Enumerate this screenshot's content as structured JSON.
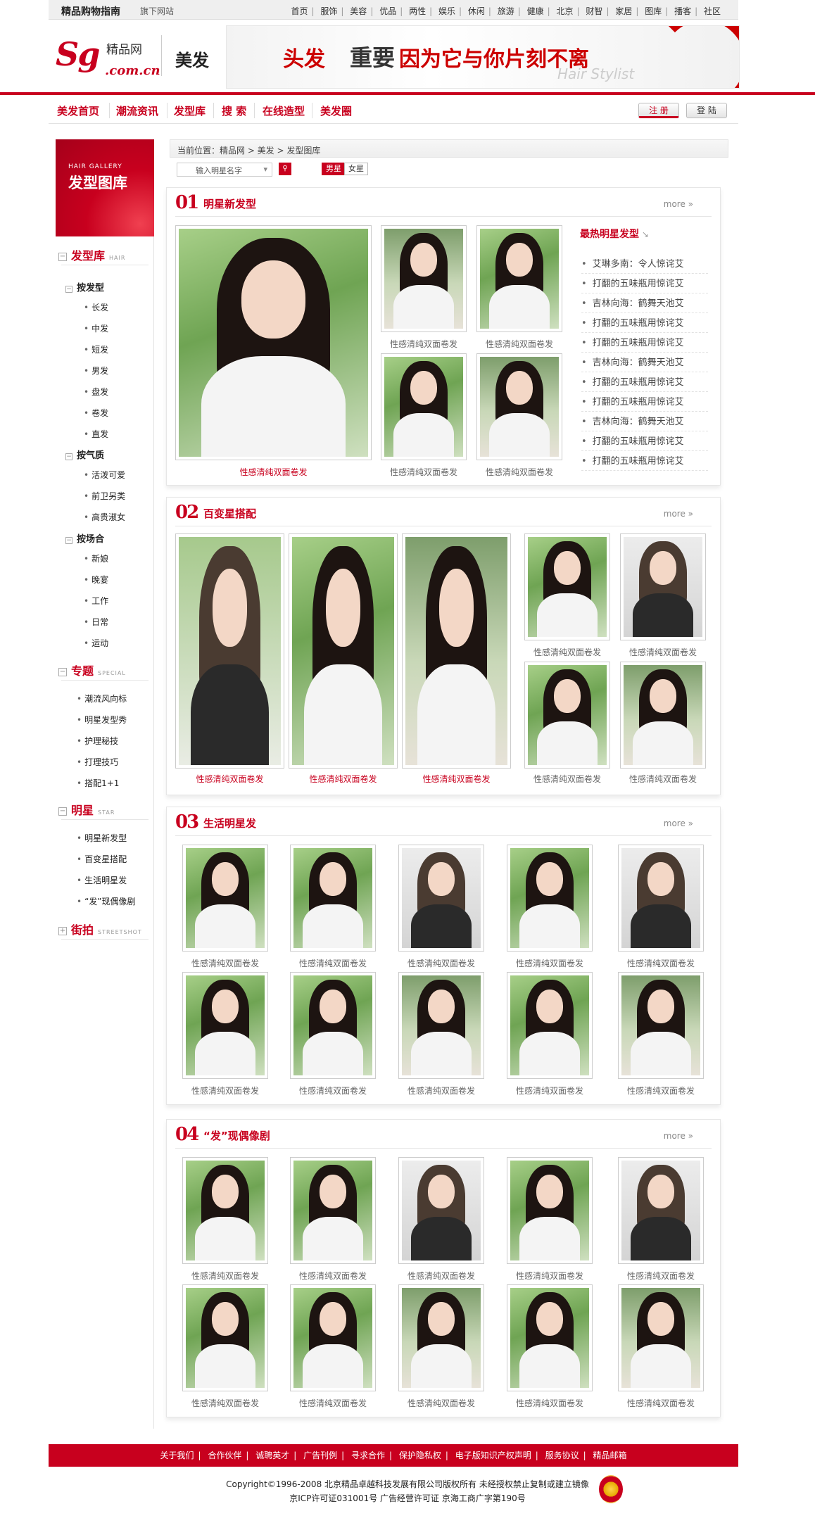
{
  "topbar": {
    "logo": "精品购物指南",
    "sub": "旗下网站",
    "nav": [
      "首页",
      "服饰",
      "美容",
      "优品",
      "两性",
      "娱乐",
      "休闲",
      "旅游",
      "健康",
      "北京",
      "财智",
      "家居",
      "图库",
      "播客",
      "社区"
    ]
  },
  "header": {
    "logo_main": "Sg",
    "logo_sub": ".com.cn",
    "logo_cn": "精品网",
    "section": "美发",
    "banner": {
      "t1": "头发",
      "t2": "重要",
      "t3": "因为它与你片刻不离",
      "t4": "Hair Stylist"
    }
  },
  "mainnav": {
    "items": [
      "美发首页",
      "潮流资讯",
      "发型库",
      "搜 索",
      "在线造型",
      "美发圈"
    ],
    "register": "注 册",
    "login": "登 陆"
  },
  "sidebar": {
    "gallery_en": "HAIR GALLERY",
    "gallery_cn": "发型图库",
    "sec1": {
      "title": "发型库",
      "en": "HAIR"
    },
    "by_length": {
      "title": "按发型",
      "items": [
        "长发",
        "中发",
        "短发",
        "男发",
        "盘发",
        "卷发",
        "直发"
      ]
    },
    "by_temper": {
      "title": "按气质",
      "items": [
        "活泼可爱",
        "前卫另类",
        "高贵淑女"
      ]
    },
    "by_occasion": {
      "title": "按场合",
      "items": [
        "新娘",
        "晚宴",
        "工作",
        "日常",
        "运动"
      ]
    },
    "sec2": {
      "title": "专题",
      "en": "SPECIAL",
      "items": [
        "潮流风向标",
        "明星发型秀",
        "护理秘技",
        "打理技巧",
        "搭配1+1"
      ]
    },
    "sec3": {
      "title": "明星",
      "en": "STAR",
      "items": [
        "明星新发型",
        "百变星搭配",
        "生活明星发",
        "“发”现偶像剧"
      ]
    },
    "sec4": {
      "title": "街拍",
      "en": "STREETSHOT"
    }
  },
  "crumb": "当前位置：精品网 > 美发 > 发型图库",
  "search": {
    "placeholder": "输入明星名字",
    "male": "男星",
    "female": "女星"
  },
  "caption": "性感清纯双面卷发",
  "panels": [
    {
      "num": "01",
      "title": "明星新发型",
      "more": "more »"
    },
    {
      "num": "02",
      "title": "百变星搭配",
      "more": "more »"
    },
    {
      "num": "03",
      "title": "生活明星发",
      "more": "more »"
    },
    {
      "num": "04",
      "title": "“发”现偶像剧",
      "more": "more »"
    }
  ],
  "hot": {
    "title": "最热明星发型",
    "items": [
      "艾琳多南：令人惊诧艾",
      "打翻的五味瓶用惊诧艾",
      "吉林向海：鹤舞天池艾",
      "打翻的五味瓶用惊诧艾",
      "打翻的五味瓶用惊诧艾",
      "吉林向海：鹤舞天池艾",
      "打翻的五味瓶用惊诧艾",
      "打翻的五味瓶用惊诧艾",
      "吉林向海：鹤舞天池艾",
      "打翻的五味瓶用惊诧艾",
      "打翻的五味瓶用惊诧艾"
    ]
  },
  "footer": {
    "links": [
      "关于我们",
      "合作伙伴",
      "诚聘英才",
      "广告刊例",
      "寻求合作",
      "保护隐私权",
      "电子版知识产权声明",
      "服务协议",
      "精品邮箱"
    ],
    "copy1": "Copyright©1996-2008 北京精品卓越科技发展有限公司版权所有 未经授权禁止复制或建立镜像",
    "copy2": "京ICP许可证031001号   广告经营许可证 京海工商广字第190号"
  }
}
